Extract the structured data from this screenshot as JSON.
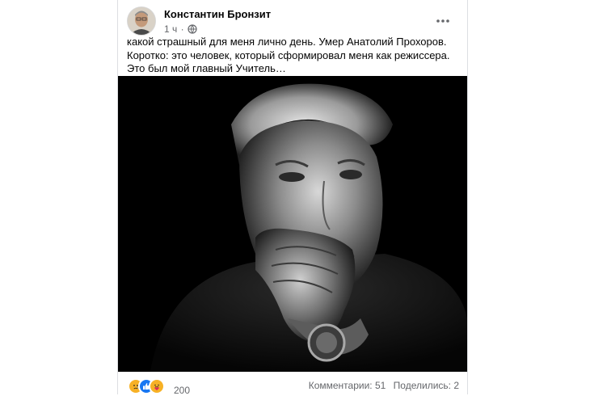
{
  "post": {
    "author": "Константин Бронзит",
    "time": "1 ч",
    "separator": "·",
    "privacy_icon": "globe-icon",
    "more_icon": "more-horizontal-icon",
    "text": "какой страшный для меня лично день. Умер Анатолий Прохоров. Коротко: это человек, который сформировал меня как режиссера. Это был мой главный Учитель…",
    "photo": "black-and-white portrait photo"
  },
  "footer": {
    "reaction_icons": [
      "sad-reaction-icon",
      "like-reaction-icon",
      "care-reaction-icon"
    ],
    "reaction_count": "200",
    "comments": "Комментарии: 51",
    "shares": "Поделились: 2"
  },
  "colors": {
    "text": "#050505",
    "secondary": "#65676b",
    "like_blue": "#1877f2",
    "reaction_yellow": "#f7b125",
    "border": "#dddfe2"
  }
}
